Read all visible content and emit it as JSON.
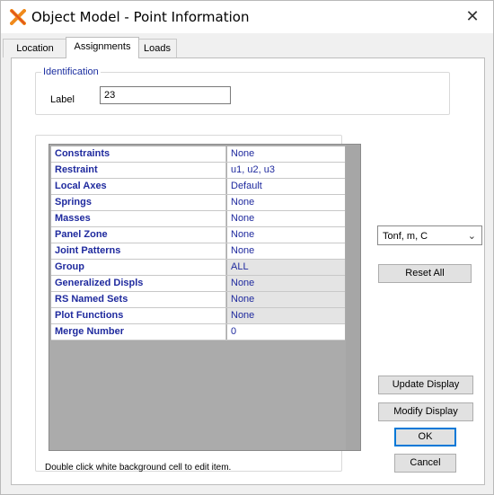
{
  "window": {
    "title": "Object Model - Point Information",
    "close_glyph": "✕",
    "app_icon": "etabs-x-icon",
    "app_icon_color": "#f08a1c"
  },
  "tabs": [
    {
      "label": "Location",
      "active": false
    },
    {
      "label": "Assignments",
      "active": true
    },
    {
      "label": "Loads",
      "active": false
    }
  ],
  "identification": {
    "legend": "Identification",
    "label_caption": "Label",
    "label_value": "23"
  },
  "grid": {
    "rows": [
      {
        "name": "Constraints",
        "value": "None",
        "editable": true
      },
      {
        "name": "Restraint",
        "value": "u1, u2, u3",
        "editable": true
      },
      {
        "name": "Local Axes",
        "value": "Default",
        "editable": true
      },
      {
        "name": "Springs",
        "value": "None",
        "editable": true
      },
      {
        "name": "Masses",
        "value": "None",
        "editable": true
      },
      {
        "name": "Panel Zone",
        "value": "None",
        "editable": true
      },
      {
        "name": "Joint Patterns",
        "value": "None",
        "editable": true
      },
      {
        "name": "Group",
        "value": "ALL",
        "editable": false
      },
      {
        "name": "Generalized Displs",
        "value": "None",
        "editable": false
      },
      {
        "name": "RS Named Sets",
        "value": "None",
        "editable": false
      },
      {
        "name": "Plot Functions",
        "value": "None",
        "editable": false
      },
      {
        "name": "Merge Number",
        "value": "0",
        "editable": true
      }
    ],
    "hint": "Double click white background cell to edit item."
  },
  "units": {
    "selected": "Tonf, m, C"
  },
  "buttons": {
    "reset_all": "Reset All",
    "update_display": "Update Display",
    "modify_display": "Modify Display",
    "ok": "OK",
    "cancel": "Cancel"
  },
  "colors": {
    "accent": "#0078d7",
    "label_text": "#1f2a9e",
    "readonly_cell": "#e4e4e4"
  }
}
